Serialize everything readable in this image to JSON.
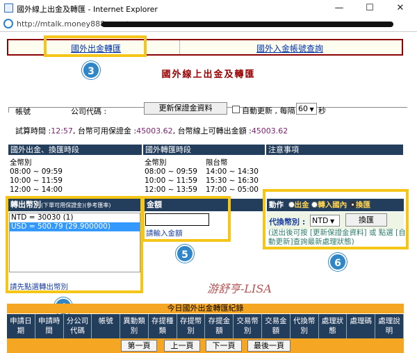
{
  "window": {
    "title": "國外線上出金及轉匯 - Internet Explorer",
    "url": "http://mtalk.money888.com.tw",
    "minimize": "—",
    "maximize": "☐",
    "close": "✕"
  },
  "tabs": {
    "outbound": "國外出金轉匯",
    "inbound": "國外入金帳號查詢"
  },
  "annotations": {
    "step3": "3",
    "step4": "4",
    "step5": "5",
    "step6": "6"
  },
  "page_title": "國外線上出金及轉匯",
  "account": {
    "account_label": "帳號",
    "company_label": "公司代碼 :",
    "refresh_button": "更新保證金資料",
    "auto_refresh_label": "自動更新 , 每隔",
    "interval_value": "60",
    "seconds_label": "秒",
    "trial_time_label": "試算時間 :",
    "trial_time_value": "12:57",
    "margin_label": ", 台幣可用保證金 :",
    "margin_value": "45003.62",
    "withdraw_label": ", 台幣線上可轉出金額 :",
    "withdraw_value": "45003.62"
  },
  "schedule": {
    "col1_header": "國外出金、換匯時段",
    "col2_header": "國外轉匯時段",
    "col3_header": "注意事項",
    "col1_title": "全幣別",
    "col1_times": [
      "08:00 ~ 09:59",
      "10:00 ~ 11:59",
      "12:00 ~ 14:00"
    ],
    "col2_title_a": "全幣別",
    "col2_times_a": [
      "08:00 ~ 09:59",
      "10:00 ~ 11:59",
      "12:00 ~ 13:59"
    ],
    "col2_title_b": "限台幣",
    "col2_times_b": [
      "14:00 ~ 14:30",
      "15:30 ~ 16:30",
      "17:00 ~ 05:00"
    ]
  },
  "currency": {
    "header": "轉出幣別",
    "header_note": "(下單可用保證金)(參考匯率)",
    "options": [
      "NTD = 30030 (1)",
      "USD = 500.79 (29.900000)"
    ],
    "hint": "請先點選轉出幣別"
  },
  "amount": {
    "header": "金額",
    "input_value": "",
    "hint": "請輸入金額"
  },
  "action": {
    "header": "動作",
    "opt_withdraw": "出金",
    "opt_transfer": "轉入國內",
    "opt_exchange": "換匯",
    "target_label": "代換幣別 :",
    "target_value": "NTD",
    "exchange_button": "換匯",
    "note": "(送出後可按 [更新保證金資料] 或 點選 [自動更新]查詢最新處理狀態)"
  },
  "records": {
    "title": "今日國外出金轉匯紀錄",
    "columns": [
      "申請日期",
      "申請時間",
      "分公司代碼",
      "帳號",
      "異動類別",
      "存提種類",
      "存提幣別",
      "存提金額",
      "交易幣別",
      "交易金額",
      "代換幣別",
      "處理狀態",
      "處理碼",
      "處理說明"
    ]
  },
  "pager": {
    "first": "第一頁",
    "prev": "上一頁",
    "next": "下一頁",
    "last": "最後一頁"
  },
  "watermark": "游舒亨-LISA"
}
